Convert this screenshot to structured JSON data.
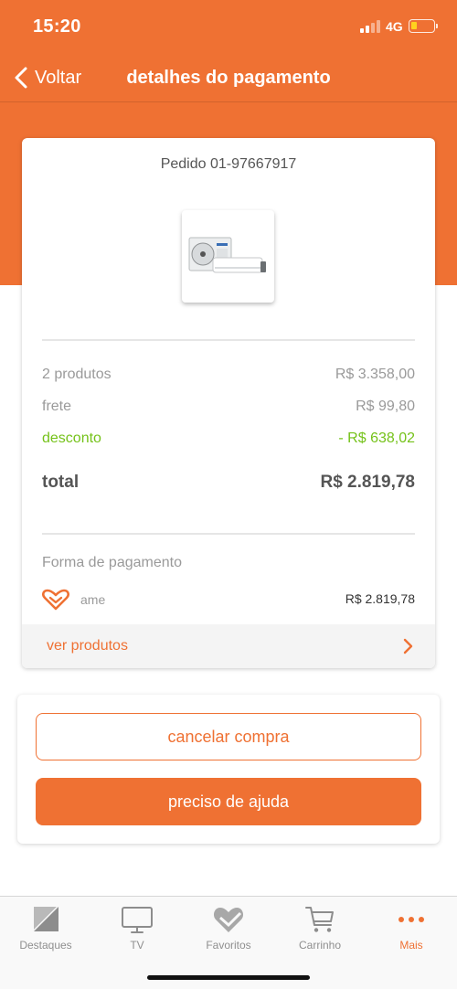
{
  "status_bar": {
    "time": "15:20",
    "network": "4G",
    "battery_level": "low"
  },
  "nav": {
    "back_label": "Voltar",
    "title": "detalhes do pagamento"
  },
  "order": {
    "id_label": "Pedido 01-97667917",
    "product_image_alt": "ar-condicionado split",
    "summary": {
      "products_label": "2 produtos",
      "products_value": "R$ 3.358,00",
      "shipping_label": "frete",
      "shipping_value": "R$ 99,80",
      "discount_label": "desconto",
      "discount_value": "- R$ 638,02",
      "total_label": "total",
      "total_value": "R$ 2.819,78"
    },
    "payment": {
      "title": "Forma de pagamento",
      "method": "ame",
      "amount": "R$ 2.819,78"
    },
    "see_products_label": "ver produtos"
  },
  "actions": {
    "cancel_label": "cancelar compra",
    "help_label": "preciso de ajuda"
  },
  "tab_bar": {
    "items": [
      {
        "label": "Destaques",
        "icon": "highlights-icon",
        "active": false
      },
      {
        "label": "TV",
        "icon": "tv-icon",
        "active": false
      },
      {
        "label": "Favoritos",
        "icon": "heart-icon",
        "active": false
      },
      {
        "label": "Carrinho",
        "icon": "cart-icon",
        "active": false
      },
      {
        "label": "Mais",
        "icon": "more-dots-icon",
        "active": true
      }
    ]
  },
  "colors": {
    "accent": "#ef7133",
    "discount": "#75c21a",
    "muted_text": "#9a9a9a"
  }
}
